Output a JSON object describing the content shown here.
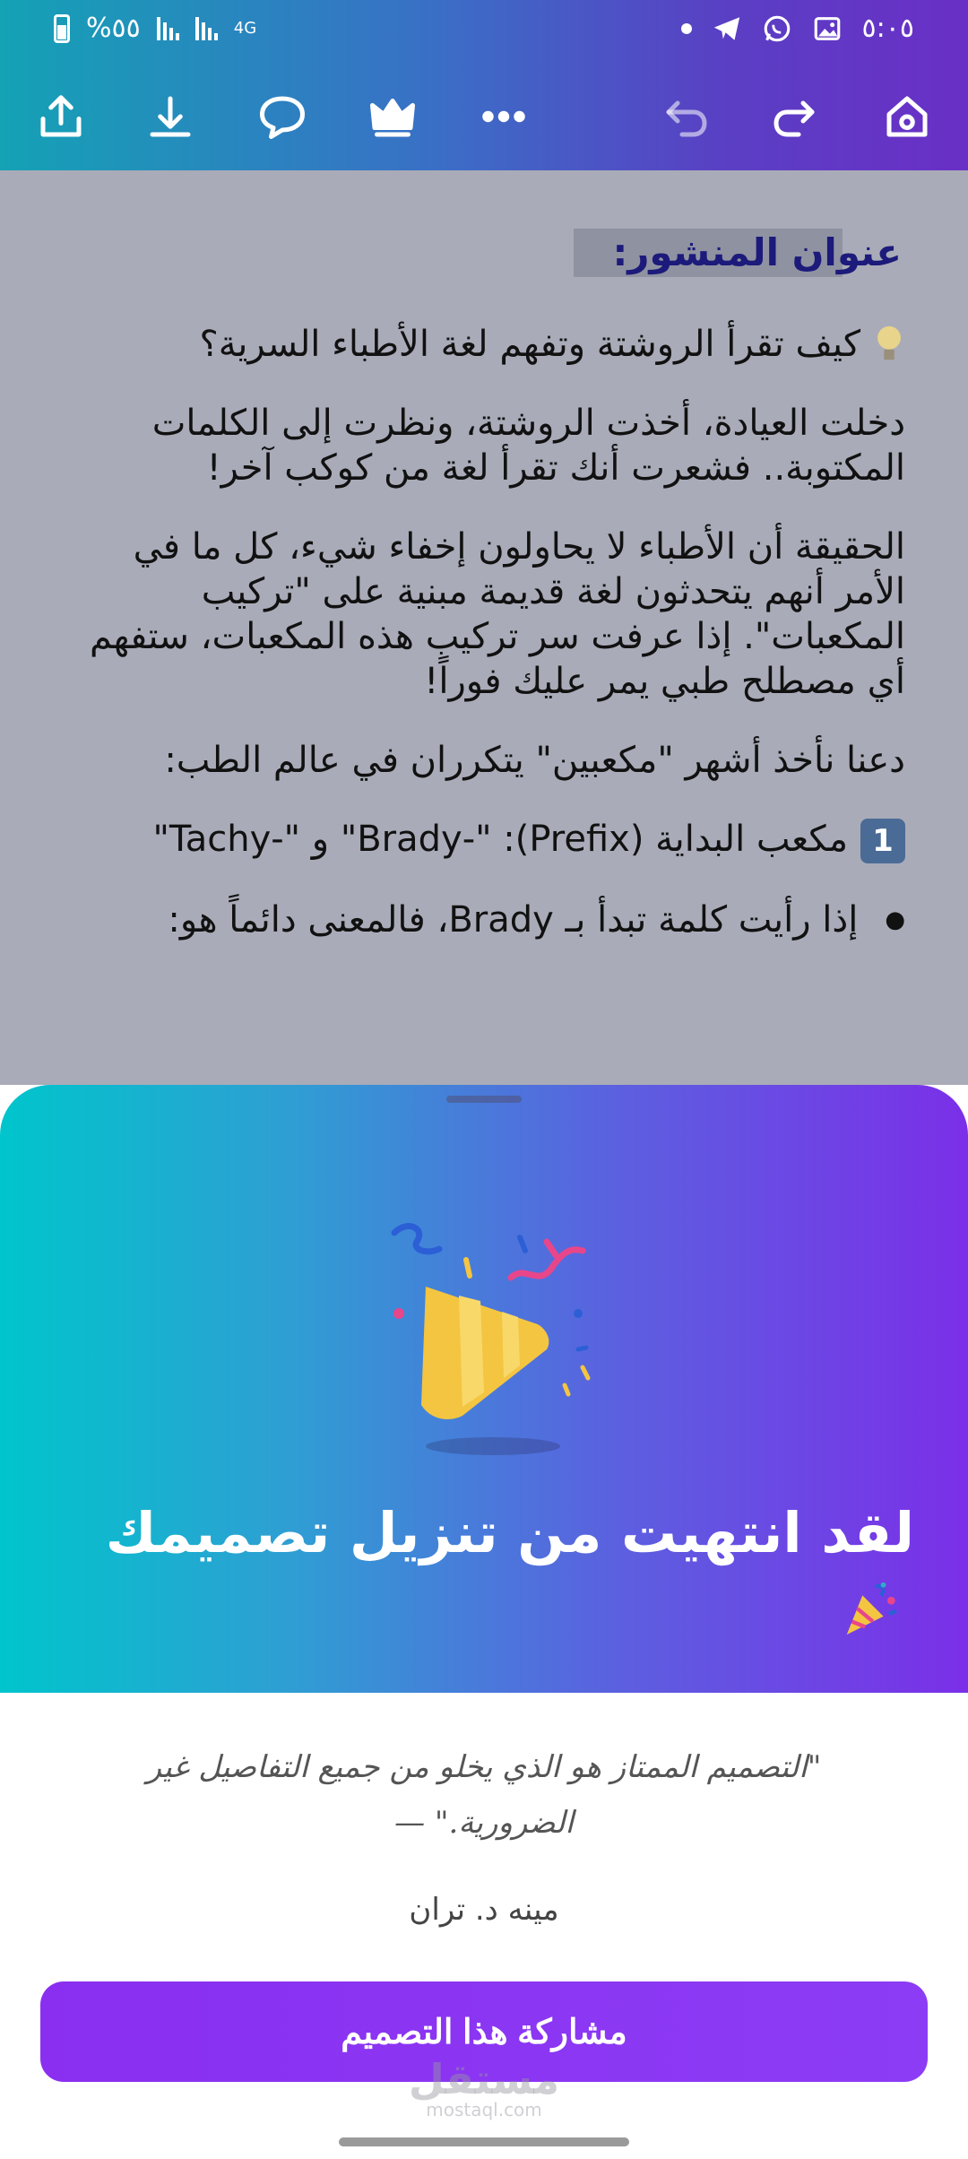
{
  "status_bar": {
    "battery": "%٥٥",
    "network": "4G",
    "time": "٥:٠٥",
    "icons": [
      "battery-icon",
      "signal-icon",
      "signal-icon",
      "notification-dot-icon",
      "telegram-icon",
      "whatsapp-icon",
      "gallery-icon"
    ]
  },
  "toolbar": {
    "icons": [
      "share-icon",
      "download-icon",
      "comment-icon",
      "crown-icon",
      "more-icon",
      "undo-icon",
      "redo-icon",
      "home-icon"
    ]
  },
  "document": {
    "title_label": "عنوان المنشور:",
    "question": "كيف تقرأ الروشتة وتفهم لغة الأطباء السرية؟",
    "paragraph1": "دخلت العيادة، أخذت الروشتة، ونظرت إلى الكلمات المكتوبة.. فشعرت أنك تقرأ لغة من كوكب آخر!",
    "paragraph2": "الحقيقة أن الأطباء لا يحاولون إخفاء شيء، كل ما في الأمر أنهم يتحدثون لغة قديمة مبنية على \"تركيب المكعبات\". إذا عرفت سر تركيب هذه المكعبات، ستفهم أي مصطلح طبي يمر عليك فوراً!",
    "paragraph3": "دعنا نأخذ أشهر \"مكعبين\" يتكرران في عالم الطب:",
    "item1_number": "1",
    "item1": "مكعب البداية (Prefix): \"-Brady\" و \"-Tachy\"",
    "bullet1": "إذا رأيت كلمة تبدأ بـ Brady، فالمعنى دائماً هو:"
  },
  "sheet": {
    "headline": "لقد انتهيت من تنزيل تصميمك",
    "quote": "\"التصميم الممتاز هو الذي يخلو من جميع التفاصيل غير الضرورية.\" —",
    "author": "مينه د. تران",
    "share_button": "مشاركة هذا التصميم",
    "watermark": "مستقل",
    "watermark_sub": "mostaql.com"
  },
  "colors": {
    "header_gradient_start": "#14a2b5",
    "header_gradient_end": "#6a2fc6",
    "sheet_gradient_start": "#00c5cc",
    "sheet_gradient_end": "#7b2fe8",
    "share_button": "#8a2ff0",
    "doc_overlay": "#a9abb8",
    "title_color": "#1c1a7a"
  }
}
